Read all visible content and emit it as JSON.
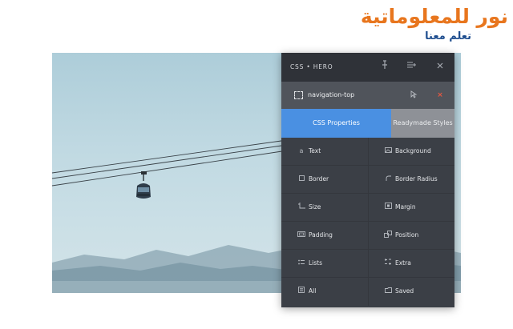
{
  "watermark": {
    "title": "نور للمعلوماتية",
    "subtitle": "تعلم معنا"
  },
  "panel": {
    "brand": "CSS • HERO",
    "header_icons": [
      "pin-icon",
      "menu-plus-icon",
      "close-icon"
    ],
    "selector": {
      "name": "navigation-top",
      "icons": [
        "select-element-icon",
        "pointer-icon",
        "remove-icon"
      ]
    },
    "tabs": [
      {
        "label": "CSS Properties",
        "active": true
      },
      {
        "label": "Readymade Styles",
        "active": false
      }
    ],
    "properties": [
      {
        "label": "Text",
        "icon": "text-icon"
      },
      {
        "label": "Background",
        "icon": "background-icon"
      },
      {
        "label": "Border",
        "icon": "border-icon"
      },
      {
        "label": "Border Radius",
        "icon": "border-radius-icon"
      },
      {
        "label": "Size",
        "icon": "size-icon"
      },
      {
        "label": "Margin",
        "icon": "margin-icon"
      },
      {
        "label": "Padding",
        "icon": "padding-icon"
      },
      {
        "label": "Position",
        "icon": "position-icon"
      },
      {
        "label": "Lists",
        "icon": "lists-icon"
      },
      {
        "label": "Extra",
        "icon": "extra-icon"
      },
      {
        "label": "All",
        "icon": "all-icon"
      },
      {
        "label": "Saved",
        "icon": "saved-icon"
      }
    ]
  },
  "colors": {
    "accent": "#4a90e2",
    "panel_bg": "#3b3f46",
    "watermark_orange": "#e8761e",
    "watermark_blue": "#1f4e8f",
    "close_red": "#e8573f"
  }
}
